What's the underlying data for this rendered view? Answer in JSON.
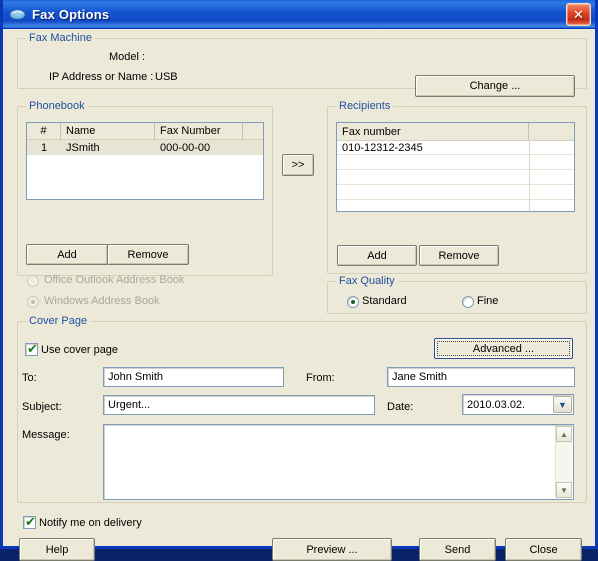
{
  "window": {
    "title": "Fax Options",
    "icon": "fax-machine-icon",
    "close_label": "✕",
    "accent_title_bar": "#1452cf",
    "face_color": "#ece9d8",
    "group_label_color": "#20519e"
  },
  "fax_machine": {
    "legend": "Fax Machine",
    "model_label": "Model :",
    "model_value": "",
    "ip_label": "IP Address or Name :",
    "ip_value": "USB",
    "change_button": "Change ..."
  },
  "phonebook": {
    "legend": "Phonebook",
    "columns": [
      "#",
      "Name",
      "Fax Number",
      ""
    ],
    "rows": [
      {
        "num": "1",
        "name": "JSmith",
        "fax": "000-00-00",
        "selected": true
      }
    ],
    "add_button": "Add",
    "remove_button": "Remove",
    "address_book_options": [
      {
        "label": "Office Outlook Address Book",
        "selected": false,
        "disabled": true
      },
      {
        "label": "Windows Address Book",
        "selected": true,
        "disabled": true
      }
    ]
  },
  "transfer": {
    "label": ">>"
  },
  "recipients": {
    "legend": "Recipients",
    "columns": [
      "Fax number",
      ""
    ],
    "rows": [
      {
        "fax": "010-12312-2345"
      }
    ],
    "add_button": "Add",
    "remove_button": "Remove"
  },
  "fax_quality": {
    "legend": "Fax Quality",
    "options": [
      {
        "label": "Standard",
        "selected": true
      },
      {
        "label": "Fine",
        "selected": false
      }
    ]
  },
  "cover_page": {
    "legend": "Cover Page",
    "use_cover_page": {
      "label": "Use cover page",
      "checked": true,
      "mark": "✔"
    },
    "advanced_button": "Advanced ...",
    "to_label": "To:",
    "to_value": "John Smith",
    "from_label": "From:",
    "from_value": "Jane Smith",
    "subject_label": "Subject:",
    "subject_value": "Urgent...",
    "date_label": "Date:",
    "date_value": "2010.03.02.",
    "date_arrow": "▼",
    "message_label": "Message:",
    "message_value": "",
    "scroll_up": "▲",
    "scroll_down": "▼"
  },
  "footer": {
    "notify": {
      "label": "Notify me on delivery",
      "checked": true,
      "mark": "✔"
    },
    "help_button": "Help",
    "preview_button": "Preview ...",
    "send_button": "Send",
    "close_button": "Close"
  }
}
